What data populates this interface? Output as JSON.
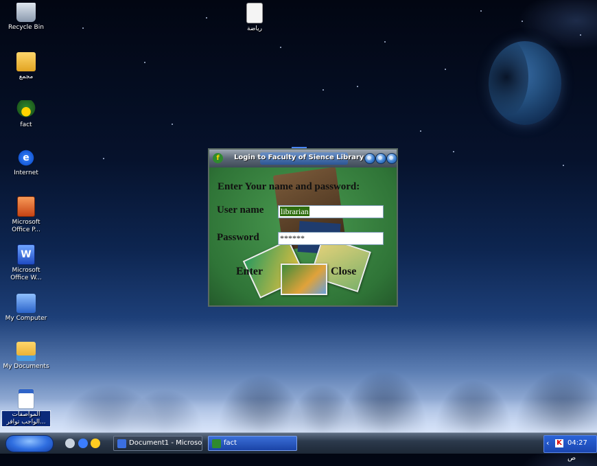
{
  "desktop": {
    "icons": [
      {
        "label": "Recycle Bin",
        "icon": "recycle-bin-icon"
      },
      {
        "label": "رياضة",
        "icon": "text-file-icon"
      },
      {
        "label": "مجمع",
        "icon": "folder-icon"
      },
      {
        "label": "fact",
        "icon": "fact-app-icon"
      },
      {
        "label": "Internet",
        "icon": "internet-explorer-icon"
      },
      {
        "label": "Microsoft Office P...",
        "icon": "powerpoint-icon"
      },
      {
        "label": "Microsoft Office W...",
        "icon": "word-icon"
      },
      {
        "label": "My Computer",
        "icon": "my-computer-icon"
      },
      {
        "label": "My Documents",
        "icon": "my-documents-icon"
      },
      {
        "label": "المواصفات ...الواجب توافر",
        "icon": "word-document-icon"
      }
    ]
  },
  "dialog": {
    "title": "Login to Faculty of Sience Library",
    "heading": "Enter Your name and password:",
    "username_label": "User name",
    "username_value": "librarian",
    "password_label": "Password",
    "password_value": "******",
    "enter_label": "Enter",
    "close_label": "Close"
  },
  "taskbar": {
    "tasks": [
      {
        "label": "Document1 - Microso...",
        "icon": "word-icon"
      },
      {
        "label": "fact",
        "icon": "fact-app-icon"
      }
    ],
    "clock": "04:27 ص",
    "colors": {
      "active_task": "#1a43a6",
      "tray": "#1a46b0"
    }
  }
}
